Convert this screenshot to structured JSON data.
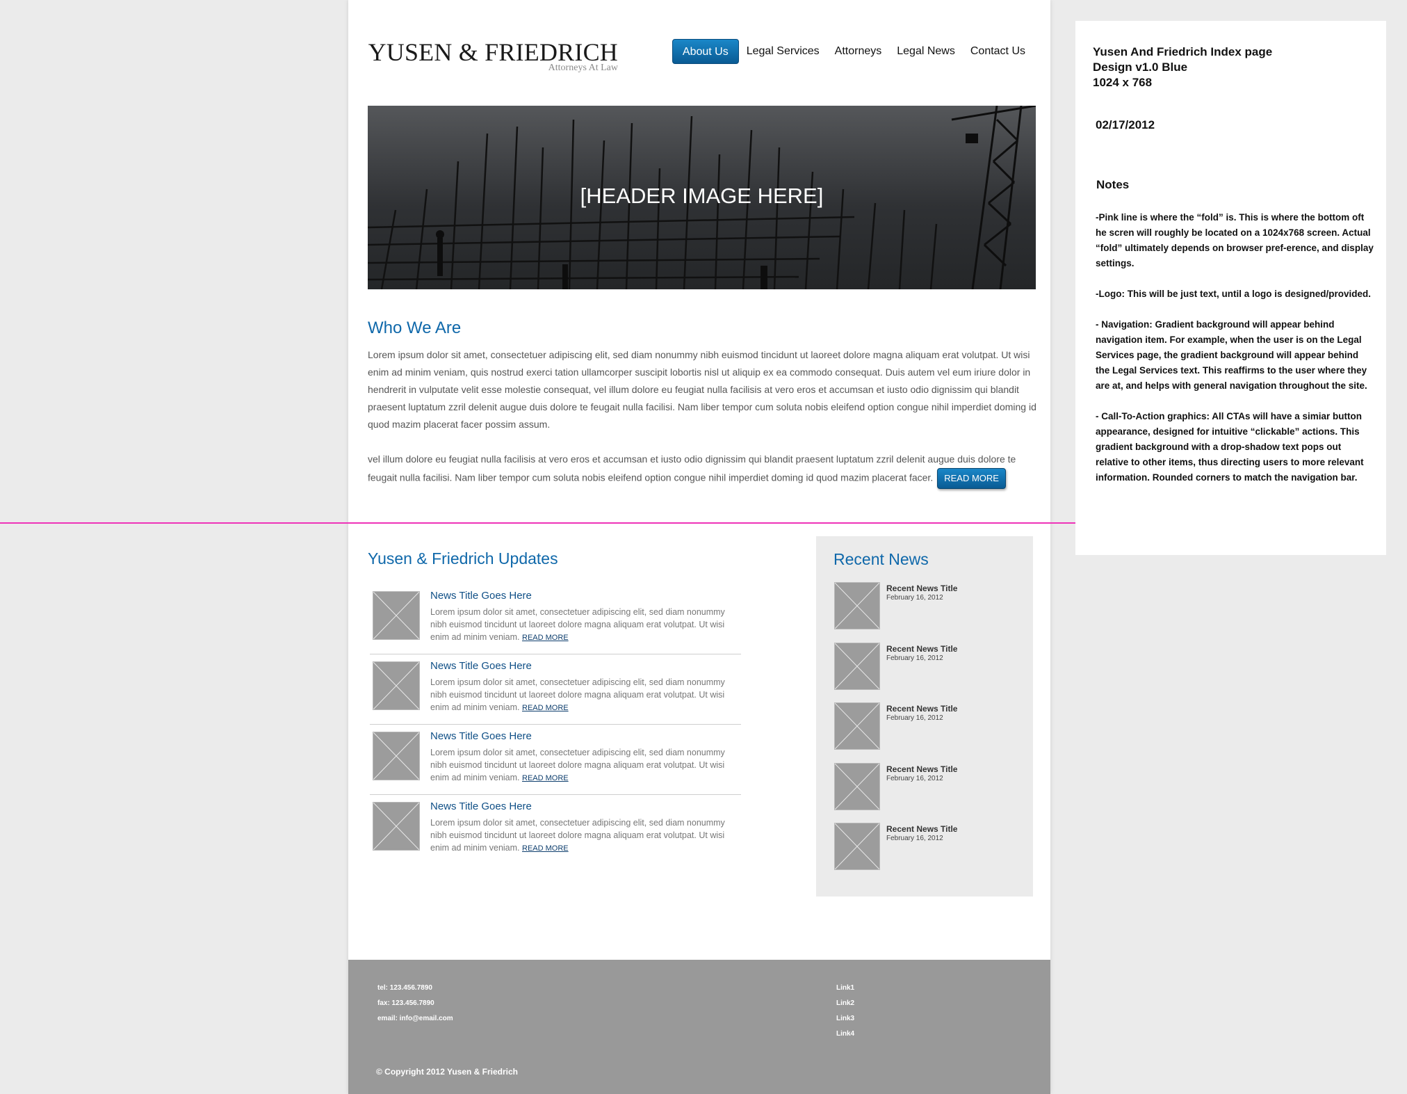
{
  "colors": {
    "accent": "#0f68aa",
    "fold_line": "#ee33b8",
    "footer": "#999999",
    "canvas": "#ebebeb"
  },
  "header": {
    "logo_title": "YUSEN & FRIEDRICH",
    "logo_subtitle": "Attorneys At Law",
    "nav": [
      {
        "label": "About Us",
        "active": true
      },
      {
        "label": "Legal Services"
      },
      {
        "label": "Attorneys"
      },
      {
        "label": "Legal News"
      },
      {
        "label": "Contact Us"
      }
    ]
  },
  "hero": {
    "text": "[HEADER IMAGE HERE]"
  },
  "about": {
    "title": "Who We Are",
    "paragraph1": "Lorem ipsum dolor sit amet, consectetuer adipiscing elit, sed diam nonummy nibh euismod tincidunt ut laoreet dolore magna aliquam erat volutpat. Ut wisi enim ad minim veniam, quis nostrud exerci tation ullamcorper suscipit lobortis nisl ut aliquip ex ea commodo consequat. Duis autem vel eum iriure dolor in hendrerit in vulputate velit esse molestie consequat, vel illum dolore eu feugiat nulla facilisis at vero eros et accumsan et iusto odio dignissim qui blandit praesent luptatum zzril delenit augue duis dolore te feugait nulla facilisi. Nam liber tempor cum soluta nobis eleifend option congue nihil imperdiet doming id quod mazim placerat facer possim assum.",
    "paragraph2": "vel illum dolore eu feugiat nulla facilisis at vero eros et accumsan et iusto odio dignissim qui blandit praesent luptatum zzril delenit augue duis dolore te feugait nulla facilisi. Nam liber tempor cum soluta nobis eleifend option congue nihil imperdiet doming id quod mazim placerat facer.",
    "read_more": "READ MORE"
  },
  "updates": {
    "title": "Yusen & Friedrich Updates",
    "items": [
      {
        "title": "News Title Goes Here",
        "text": "Lorem ipsum dolor sit amet, consectetuer adipiscing elit, sed diam nonummy nibh euismod tincidunt ut laoreet dolore magna aliquam erat volutpat. Ut wisi enim ad minim veniam.",
        "link": "READ MORE"
      },
      {
        "title": "News Title Goes Here",
        "text": "Lorem ipsum dolor sit amet, consectetuer adipiscing elit, sed diam nonummy nibh euismod tincidunt ut laoreet dolore magna aliquam erat volutpat. Ut wisi enim ad minim veniam.",
        "link": "READ MORE"
      },
      {
        "title": "News Title Goes Here",
        "text": "Lorem ipsum dolor sit amet, consectetuer adipiscing elit, sed diam nonummy nibh euismod tincidunt ut laoreet dolore magna aliquam erat volutpat. Ut wisi enim ad minim veniam.",
        "link": "READ MORE"
      },
      {
        "title": "News Title Goes Here",
        "text": "Lorem ipsum dolor sit amet, consectetuer adipiscing elit, sed diam nonummy nibh euismod tincidunt ut laoreet dolore magna aliquam erat volutpat. Ut wisi enim ad minim veniam.",
        "link": "READ MORE"
      }
    ]
  },
  "recent_news": {
    "title": "Recent News",
    "items": [
      {
        "title": "Recent News Title",
        "date": "February 16, 2012"
      },
      {
        "title": "Recent News Title",
        "date": "February 16, 2012"
      },
      {
        "title": "Recent News Title",
        "date": "February 16, 2012"
      },
      {
        "title": "Recent News Title",
        "date": "February 16, 2012"
      },
      {
        "title": "Recent News Title",
        "date": "February 16, 2012"
      }
    ]
  },
  "footer": {
    "tel": "tel: 123.456.7890",
    "fax": "fax: 123.456.7890",
    "email": "email: info@email.com",
    "links": [
      "Link1",
      "Link2",
      "Link3",
      "Link4"
    ],
    "copyright": "© Copyright 2012 Yusen & Friedrich"
  },
  "notes": {
    "title_line1": "Yusen And Friedrich Index page",
    "title_line2": "Design v1.0 Blue",
    "title_line3": "1024 x 768",
    "date": "02/17/2012",
    "heading": "Notes",
    "items": [
      "-Pink line is where the “fold” is. This is where the bottom oft he scren will roughly be located on a 1024x768 screen. Actual “fold” ultimately depends on browser pref-erence, and display settings.",
      "-Logo: This will be just text, until a logo is designed/provided.",
      "- Navigation: Gradient background will appear behind navigation item. For example, when the user is on the Legal Services page, the gradient background will appear behind the Legal Services text. This reaffirms to the user where they are at, and helps with general navigation throughout the site.",
      "- Call-To-Action graphics: All CTAs will have a simiar button appearance, designed for intuitive “clickable” actions. This gradient background with a drop-shadow text pops out relative to other items, thus directing users to more relevant information. Rounded corners to match the navigation bar."
    ]
  }
}
